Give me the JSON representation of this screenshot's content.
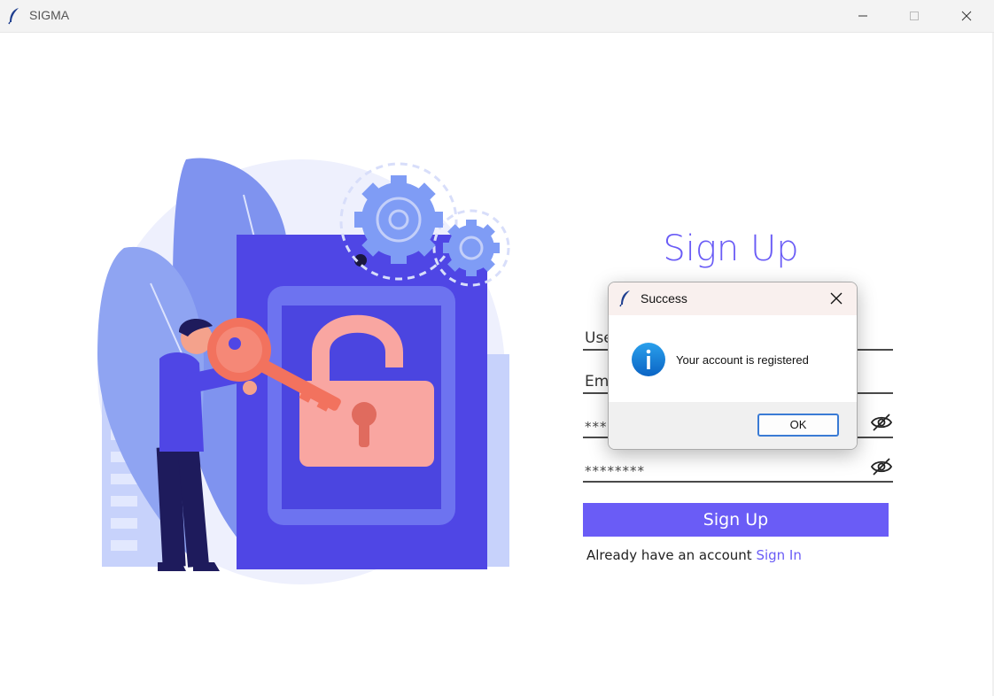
{
  "window": {
    "title": "SIGMA",
    "icon": "feather-icon"
  },
  "form": {
    "heading": "Sign Up",
    "username_placeholder": "Use",
    "email_placeholder": "Em",
    "password_value": "***",
    "confirm_password_value": "********",
    "submit_label": "Sign Up",
    "signin_prompt": "Already have an account",
    "signin_link": "Sign In"
  },
  "dialog": {
    "title": "Success",
    "message": "Your account is registered",
    "ok_label": "OK",
    "icon": "info-icon"
  },
  "colors": {
    "accent": "#6a5cf6",
    "illustration_primary": "#4f46e5",
    "lock_pink": "#f9a6a1"
  }
}
